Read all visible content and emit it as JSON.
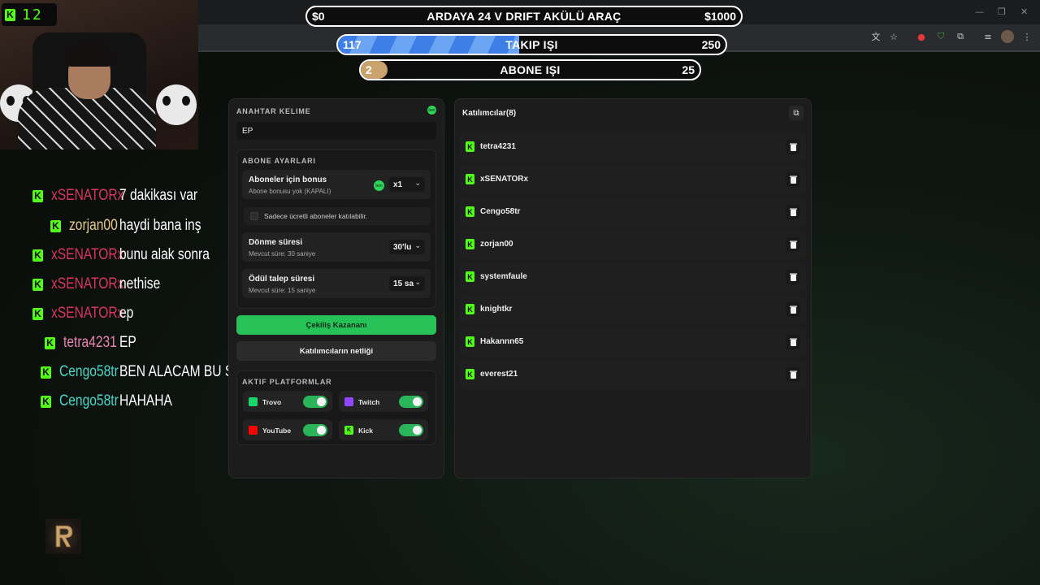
{
  "goals": [
    {
      "low": "$0",
      "title": "ARDAYA 24 V DRIFT AKÜLÜ ARAÇ",
      "high": "$1000",
      "progress": 0.0
    },
    {
      "low": "117",
      "title": "TAKIP IŞI",
      "high": "250",
      "progress": 0.468
    },
    {
      "low": "2",
      "title": "ABONE IŞI",
      "high": "25",
      "progress": 0.08
    }
  ],
  "webcam": {
    "viewer_count": "12"
  },
  "chat": [
    {
      "user": "xSENATORx",
      "message": "7 dakikası var",
      "user_color": "#d8365e"
    },
    {
      "user": "zorjan00",
      "message": "haydi bana inş",
      "user_color": "#e7c98a"
    },
    {
      "user": "xSENATORx",
      "message": "bunu alak sonra",
      "user_color": "#d8365e"
    },
    {
      "user": "xSENATORx",
      "message": "nethise",
      "user_color": "#d8365e"
    },
    {
      "user": "xSENATORx",
      "message": "ep",
      "user_color": "#d8365e"
    },
    {
      "user": "tetra4231",
      "message": "EP",
      "user_color": "#e885b0"
    },
    {
      "user": "Cengo58tr",
      "message": "BEN ALACAM BU SEFER",
      "user_color": "#46d6c8"
    },
    {
      "user": "Cengo58tr",
      "message": "HAHAHA",
      "user_color": "#46d6c8"
    }
  ],
  "left_panel": {
    "keyword_label": "ANAHTAR KELIME",
    "keyword_value": "EP",
    "badge_text": "ben",
    "sub_settings_label": "ABONE AYARLARI",
    "bonus": {
      "title": "Aboneler için bonus",
      "subtitle": "Abone bonusu yok (KAPALI)",
      "badge": "ben",
      "value": "x1"
    },
    "paid_only_label": "Sadece ücretli aboneler katılabilir.",
    "spin": {
      "title": "Dönme süresi",
      "subtitle": "Mevcut süre: 30 saniye",
      "value": "30'lu"
    },
    "claim": {
      "title": "Ödül talep süresi",
      "subtitle": "Mevcut süre: 15 saniye",
      "value": "15 sa"
    },
    "draw_button": "Çekiliş Kazananı",
    "participants_button": "Katılımcıların netliği",
    "platforms_label": "AKTIF PLATFORMLAR",
    "platforms": [
      {
        "name": "Trovo",
        "enabled": true,
        "color": "#19d66b"
      },
      {
        "name": "Twitch",
        "enabled": true,
        "color": "#9146ff"
      },
      {
        "name": "YouTube",
        "enabled": true,
        "color": "#ff0000"
      },
      {
        "name": "Kick",
        "enabled": true,
        "color": "#53fc18"
      }
    ]
  },
  "participants": {
    "title": "Katılımcılar(8)",
    "list": [
      "tetra4231",
      "xSENATORx",
      "Cengo58tr",
      "zorjan00",
      "systemfaule",
      "knightkr",
      "Hakannn65",
      "everest21"
    ]
  },
  "colors": {
    "accent": "#27c257",
    "kick": "#53fc18"
  }
}
